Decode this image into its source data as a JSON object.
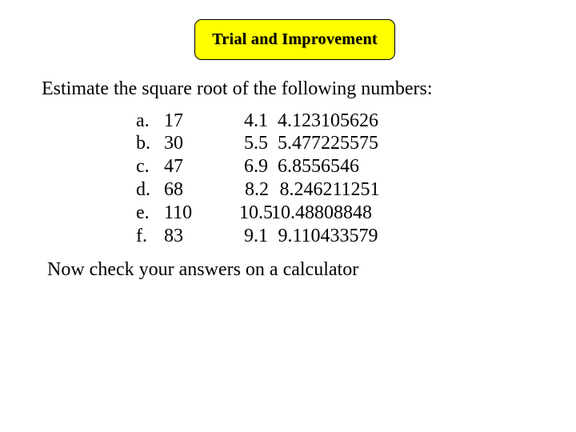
{
  "slide": {
    "title": "Trial and Improvement",
    "title_background": "#ffff00",
    "instruction": "Estimate the square root of the following numbers:",
    "rows": [
      {
        "letter": "a.",
        "number": "17",
        "estimate": "4.1",
        "exact": "4.123105626"
      },
      {
        "letter": "b.",
        "number": "30",
        "estimate": "5.5",
        "exact": "5.477225575"
      },
      {
        "letter": "c.",
        "number": "47",
        "estimate": "6.9",
        "exact": "6.8556546"
      },
      {
        "letter": "d.",
        "number": "68",
        "estimate": "8.2",
        "exact": "8.246211251"
      },
      {
        "letter": "e.",
        "number": "110",
        "estimate": "10.5",
        "exact": "10.48808848"
      },
      {
        "letter": "f.",
        "number": "83",
        "estimate": "9.1",
        "exact": "9.110433579"
      }
    ],
    "footer": "Now check your answers on a calculator"
  }
}
